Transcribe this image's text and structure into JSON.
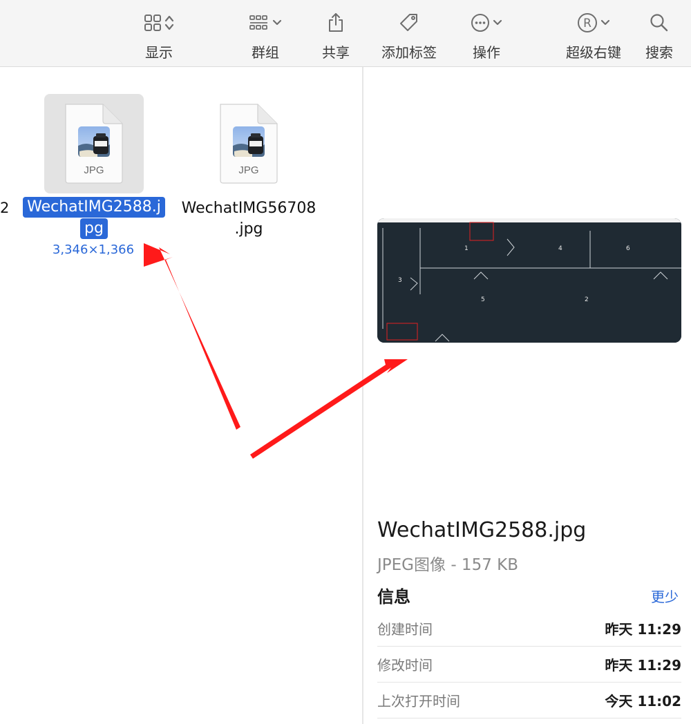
{
  "toolbar": {
    "items": [
      {
        "label": "显示",
        "icon": "icon-grid-view-icon"
      },
      {
        "label": "群组",
        "icon": "group-icon"
      },
      {
        "label": "共享",
        "icon": "share-icon"
      },
      {
        "label": "添加标签",
        "icon": "tag-icon"
      },
      {
        "label": "操作",
        "icon": "ellipsis-circle-icon"
      },
      {
        "label": "超级右键",
        "icon": "registered-icon"
      },
      {
        "label": "搜索",
        "icon": "search-icon"
      }
    ]
  },
  "files": {
    "cut_label": "2",
    "selected": {
      "name_line1": "WechatIMG2588.j",
      "name_line2": "pg",
      "dims": "3,346×1,366",
      "badge": "JPG"
    },
    "other": {
      "name_line1": "WechatIMG56708",
      "name_line2": ".jpg",
      "badge": "JPG"
    }
  },
  "preview": {
    "cells": [
      "1",
      "4",
      "6",
      "3",
      "5",
      "2"
    ],
    "title": "WechatIMG2588.jpg",
    "subtitle": "JPEG图像 - 157 KB",
    "info_heading": "信息",
    "more_label": "更少",
    "rows": [
      {
        "key": "创建时间",
        "value": "昨天 11:29"
      },
      {
        "key": "修改时间",
        "value": "昨天 11:29"
      },
      {
        "key": "上次打开时间",
        "value": "今天 11:02"
      }
    ]
  },
  "colors": {
    "accent": "#2a68d8",
    "arrow": "#ff1a1a",
    "preview_bg": "#1f2a33"
  }
}
